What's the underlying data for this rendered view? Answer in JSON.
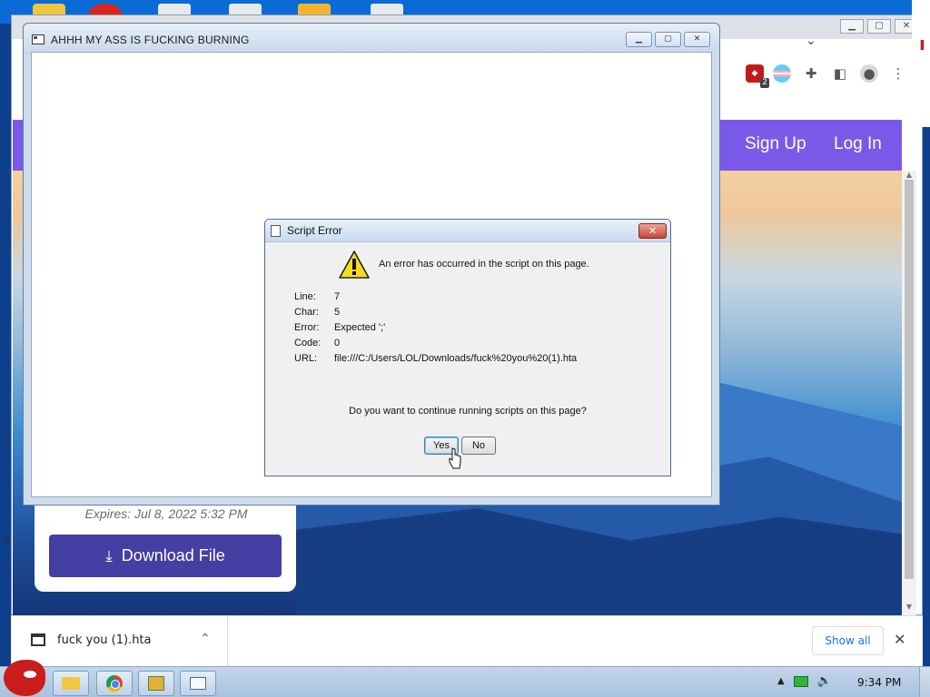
{
  "hta_window": {
    "title": "AHHH MY ASS IS FUCKING BURNING",
    "minimize": "▁",
    "maximize": "▢",
    "close": "✕"
  },
  "dialog": {
    "title": "Script Error",
    "close": "✕",
    "message": "An error has occurred in the script on this page.",
    "details": [
      {
        "label": "Line:",
        "value": "7"
      },
      {
        "label": "Char:",
        "value": "5"
      },
      {
        "label": "Error:",
        "value": "Expected ';'"
      },
      {
        "label": "Code:",
        "value": "0"
      },
      {
        "label": "URL:",
        "value": "file:///C:/Users/LOL/Downloads/fuck%20you%20(1).hta"
      }
    ],
    "question": "Do you want to continue running scripts on this page?",
    "yes_label": "Yes",
    "no_label": "No"
  },
  "browser": {
    "nav": {
      "signup": "Sign Up",
      "login": "Log In"
    },
    "card": {
      "expires": "Expires: Jul 8, 2022 5:32 PM",
      "download_label": "Download File"
    },
    "extension_badge": "2",
    "left_edge_letters": [
      "C",
      "w"
    ]
  },
  "download_shelf": {
    "file_name": "fuck you (1).hta",
    "show_all": "Show all"
  },
  "taskbar": {
    "clock": "9:34 PM"
  },
  "colors": {
    "site_nav": "#7b59e8",
    "download_button": "#453ea3",
    "dialog_close": "#c7462f"
  }
}
